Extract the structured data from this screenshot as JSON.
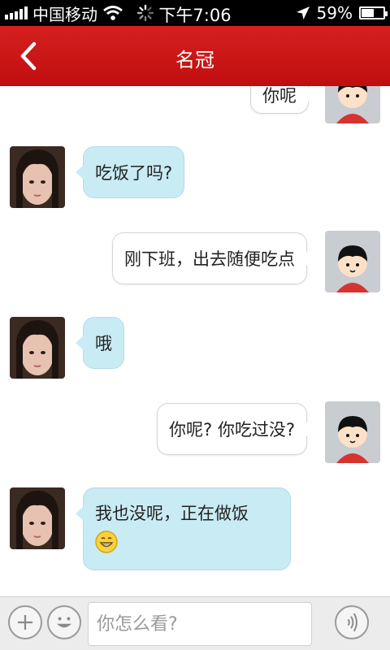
{
  "status_bar": {
    "carrier": "中国移动",
    "time": "下午7:06",
    "battery": "59%",
    "battery_level": 0.59,
    "icons": [
      "signal-icon",
      "wifi-icon",
      "activity-spinner-icon",
      "location-arrow-icon",
      "battery-icon"
    ]
  },
  "header": {
    "title": "名冠",
    "back_icon": "chevron-left-icon",
    "background": "#cc1414"
  },
  "messages": [
    {
      "from": "me",
      "text": "你呢"
    },
    {
      "from": "them",
      "text": "吃饭了吗?"
    },
    {
      "from": "me",
      "text": "刚下班，出去随便吃点"
    },
    {
      "from": "them",
      "text": "哦"
    },
    {
      "from": "me",
      "text": "你呢? 你吃过没?"
    },
    {
      "from": "them",
      "text": "我也没呢，正在做饭",
      "emoji": "grinning-face-icon"
    }
  ],
  "input_bar": {
    "placeholder": "你怎么看?",
    "icons": [
      "plus-icon",
      "smiley-icon",
      "voice-icon"
    ]
  },
  "colors": {
    "incoming_bubble": "#c9ebf3",
    "outgoing_bubble": "#ffffff",
    "accent_red": "#cc1414"
  }
}
